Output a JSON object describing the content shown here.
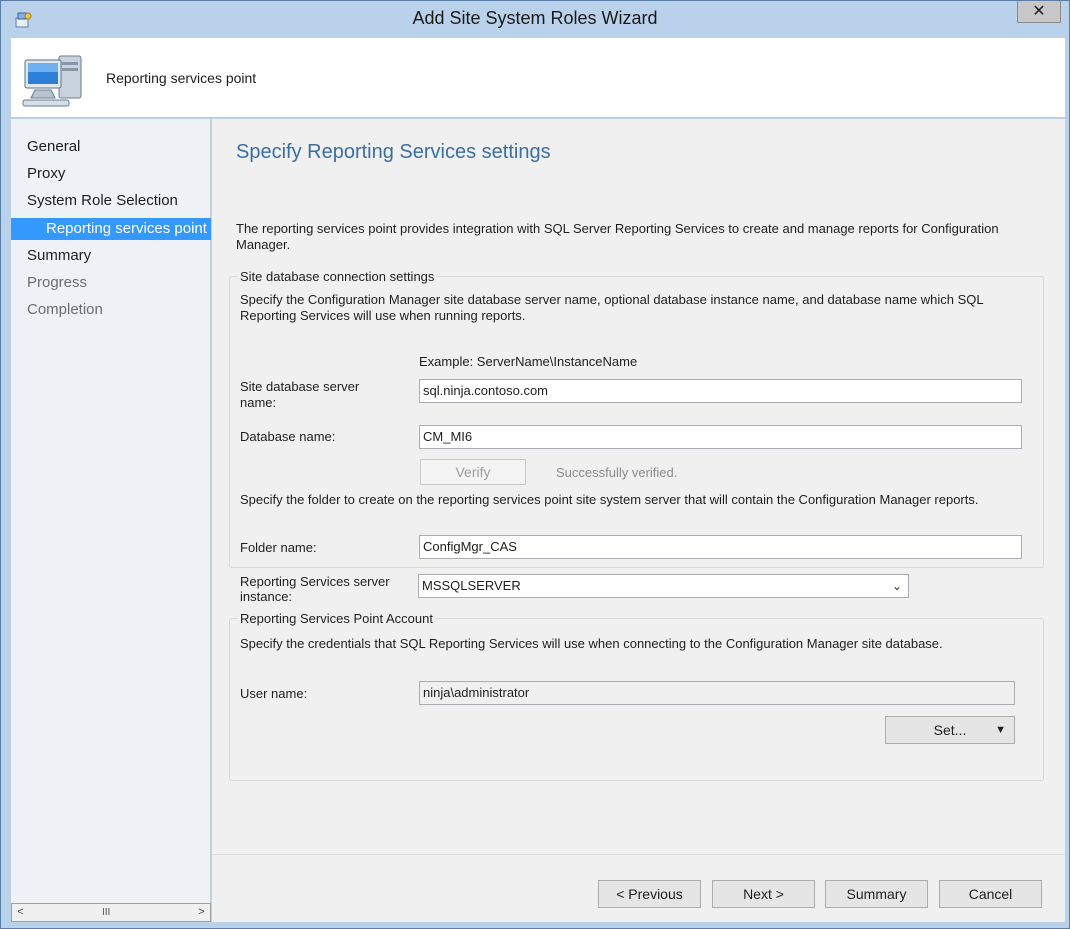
{
  "window": {
    "title": "Add Site System Roles Wizard",
    "close_glyph": "✕"
  },
  "header": {
    "page_name": "Reporting services point"
  },
  "nav": {
    "items": [
      {
        "label": "General",
        "state": "normal"
      },
      {
        "label": "Proxy",
        "state": "normal"
      },
      {
        "label": "System Role Selection",
        "state": "normal"
      },
      {
        "label": "Reporting services point",
        "state": "active"
      },
      {
        "label": "Summary",
        "state": "normal"
      },
      {
        "label": "Progress",
        "state": "disabled"
      },
      {
        "label": "Completion",
        "state": "disabled"
      }
    ],
    "scroll_left": "<",
    "scroll_right": ">",
    "scroll_grip": "III"
  },
  "main": {
    "title": "Specify Reporting Services settings",
    "description": "The reporting services point provides integration with SQL Server Reporting Services to create and manage reports for Configuration Manager.",
    "db_group": {
      "label": "Site database connection settings",
      "instructions": "Specify the Configuration Manager site database server name, optional database instance name, and database name which SQL Reporting Services will use when running reports.",
      "example": "Example: ServerName\\InstanceName",
      "server_label": "Site database server name:",
      "server_value": "sql.ninja.contoso.com",
      "dbname_label": "Database name:",
      "dbname_value": "CM_MI6",
      "verify_label": "Verify",
      "verify_status": "Successfully verified.",
      "folder_instructions": "Specify the folder to create on the reporting services point site system server that will contain the Configuration Manager reports.",
      "folder_label": "Folder name:",
      "folder_value": "ConfigMgr_CAS"
    },
    "instance": {
      "label": "Reporting Services server instance:",
      "value": "MSSQLSERVER"
    },
    "account_group": {
      "label": "Reporting Services Point Account",
      "instructions": "Specify the credentials that SQL Reporting Services will use when connecting to the Configuration Manager site database.",
      "user_label": "User name:",
      "user_value": "ninja\\administrator",
      "set_label": "Set..."
    }
  },
  "footer": {
    "previous": "< Previous",
    "next": "Next >",
    "summary": "Summary",
    "cancel": "Cancel"
  },
  "colors": {
    "accent": "#3399ff",
    "title_blue": "#3a6ea5",
    "window_frame": "#b9d1ea"
  }
}
